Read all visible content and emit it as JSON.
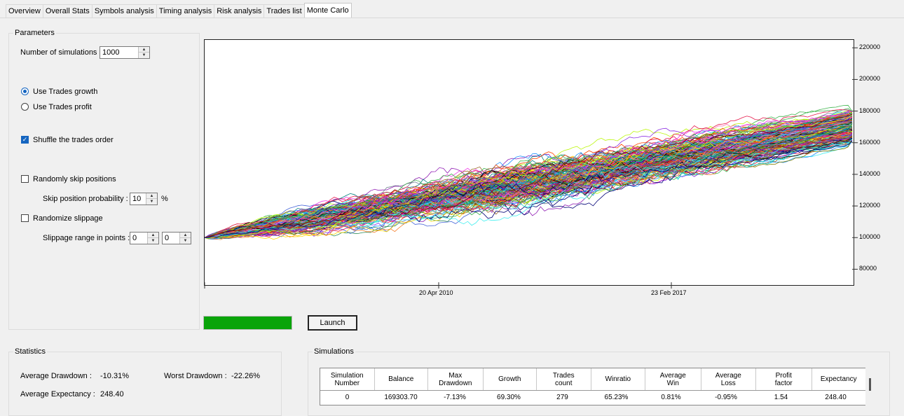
{
  "tabs": [
    "Overview",
    "Overall Stats",
    "Symbols analysis",
    "Timing analysis",
    "Risk analysis",
    "Trades list",
    "Monte Carlo"
  ],
  "active_tab": "Monte Carlo",
  "parameters": {
    "title": "Parameters",
    "num_simulations_label": "Number of simulations :",
    "num_simulations_value": "1000",
    "use_trades_growth": "Use Trades growth",
    "use_trades_growth_selected": true,
    "use_trades_profit": "Use Trades profit",
    "use_trades_profit_selected": false,
    "shuffle_label": "Shuffle the trades order",
    "shuffle_checked": true,
    "skip_positions_label": "Randomly skip positions",
    "skip_positions_checked": false,
    "skip_probability_label": "Skip position probability :",
    "skip_probability_value": "10",
    "skip_probability_unit": "%",
    "slippage_label": "Randomize slippage",
    "slippage_checked": false,
    "slippage_range_label": "Slippage range in points :",
    "slippage_min": "0",
    "slippage_max": "0"
  },
  "progress": 1.0,
  "launch_label": "Launch",
  "chart_data": {
    "type": "line",
    "y_ticks": [
      "220000",
      "200000",
      "180000",
      "160000",
      "140000",
      "120000",
      "100000",
      "80000"
    ],
    "ylim": [
      70000,
      225000
    ],
    "x_ticks": [
      "20 Apr 2010",
      "23 Feb 2017"
    ],
    "start_value": 100000,
    "end_value_range": [
      160000,
      180000
    ],
    "series_count": 1000,
    "grid": false,
    "legend": "none"
  },
  "statistics": {
    "title": "Statistics",
    "avg_drawdown_label": "Average Drawdown :",
    "avg_drawdown_value": "-10.31%",
    "worst_drawdown_label": "Worst Drawdown :",
    "worst_drawdown_value": "-22.26%",
    "avg_expectancy_label": "Average Expectancy :",
    "avg_expectancy_value": "248.40"
  },
  "simulations": {
    "title": "Simulations",
    "columns": [
      "Simulation\nNumber",
      "Balance",
      "Max\nDrawdown",
      "Growth",
      "Trades\ncount",
      "Winratio",
      "Average\nWin",
      "Average\nLoss",
      "Profit\nfactor",
      "Expectancy"
    ],
    "rows": [
      [
        "0",
        "169303.70",
        "-7.13%",
        "69.30%",
        "279",
        "65.23%",
        "0.81%",
        "-0.95%",
        "1.54",
        "248.40"
      ]
    ]
  }
}
